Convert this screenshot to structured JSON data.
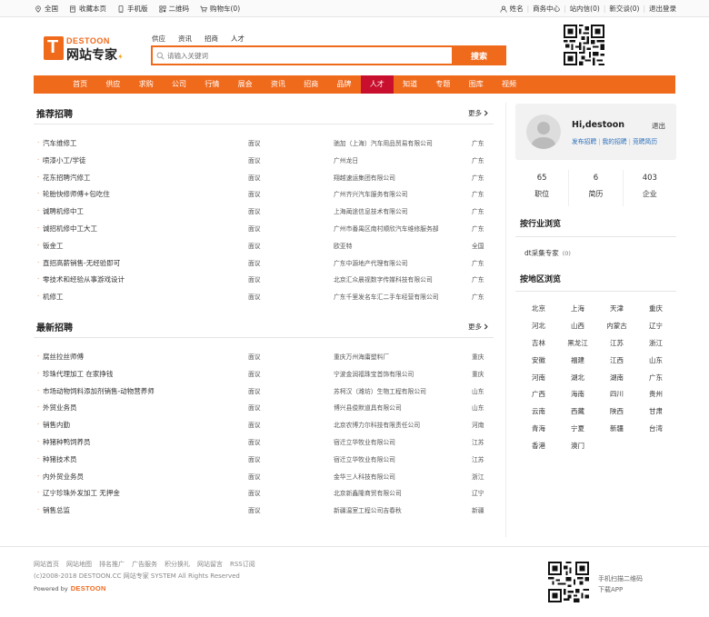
{
  "topbar": {
    "left": [
      {
        "icon": "location-icon",
        "label": "全国"
      },
      {
        "icon": "bookmark-icon",
        "label": "收藏本页"
      },
      {
        "icon": "phone-icon",
        "label": "手机版"
      },
      {
        "icon": "qrcode-icon",
        "label": "二维码"
      },
      {
        "icon": "cart-icon",
        "label": "购物车(0)"
      }
    ],
    "right": [
      "姓名",
      "商务中心",
      "站内信(0)",
      "新交谈(0)",
      "退出登录"
    ]
  },
  "logo": {
    "en": "DESTOON",
    "cn": "网站专家"
  },
  "search": {
    "tabs": [
      "供应",
      "资讯",
      "招商",
      "人才"
    ],
    "placeholder": "请输入关键词",
    "button": "搜索"
  },
  "nav": {
    "items": [
      "首页",
      "供应",
      "求购",
      "公司",
      "行情",
      "展会",
      "资讯",
      "招商",
      "品牌",
      "人才",
      "知道",
      "专题",
      "图库",
      "视频"
    ],
    "active": "人才"
  },
  "recommended": {
    "title": "推荐招聘",
    "more": "更多",
    "rows": [
      {
        "job": "汽车维修工",
        "salary": "面议",
        "company": "驰加（上海）汽车用品贸易有限公司",
        "area": "广东"
      },
      {
        "job": "喷漆小工/学徒",
        "salary": "面议",
        "company": "广州龙日",
        "area": "广东"
      },
      {
        "job": "花东招聘汽修工",
        "salary": "面议",
        "company": "翔越速运集团有限公司",
        "area": "广东"
      },
      {
        "job": "轮胎快修师傅+包吃住",
        "salary": "面议",
        "company": "广州齐兴汽车服务有限公司",
        "area": "广东"
      },
      {
        "job": "诚聘机修中工",
        "salary": "面议",
        "company": "上海蔺途信息技术有限公司",
        "area": "广东"
      },
      {
        "job": "诚招机修中工大工",
        "salary": "面议",
        "company": "广州市番禺区南村顺欣汽车维修服务部",
        "area": "广东"
      },
      {
        "job": "钣金工",
        "salary": "面议",
        "company": "欧亚特",
        "area": "全国"
      },
      {
        "job": "直招高薪销售-无经验即可",
        "salary": "面议",
        "company": "广东中源地产代理有限公司",
        "area": "广东"
      },
      {
        "job": "零技术和经验从事游戏设计",
        "salary": "面议",
        "company": "北京汇众晨视数字传媒科技有限公司",
        "area": "广东"
      },
      {
        "job": "机修工",
        "salary": "面议",
        "company": "广东千里发名车汇二手车经营有限公司",
        "area": "广东"
      }
    ]
  },
  "latest": {
    "title": "最新招聘",
    "more": "更多",
    "rows": [
      {
        "job": "腐丝拉丝师傅",
        "salary": "面议",
        "company": "重庆万州海庸塑料厂",
        "area": "重庆"
      },
      {
        "job": "珍珠代理加工 在家挣钱",
        "salary": "面议",
        "company": "宁波金润福珠宝首饰有限公司",
        "area": "重庆"
      },
      {
        "job": "市场动物饲料添加剂销售-动物营养师",
        "salary": "面议",
        "company": "苏柯汉（潍坊）生物工程有限公司",
        "area": "山东"
      },
      {
        "job": "外贸业务员",
        "salary": "面议",
        "company": "博兴县俊默道具有限公司",
        "area": "山东"
      },
      {
        "job": "销售内勤",
        "salary": "面议",
        "company": "北京农博力尔科技有限责任公司",
        "area": "河南"
      },
      {
        "job": "种猪种鸭饲养员",
        "salary": "面议",
        "company": "宿迁立华牧业有限公司",
        "area": "江苏"
      },
      {
        "job": "种猪技术员",
        "salary": "面议",
        "company": "宿迁立华牧业有限公司",
        "area": "江苏"
      },
      {
        "job": "内外贸业务员",
        "salary": "面议",
        "company": "金华三人科技有限公司",
        "area": "浙江"
      },
      {
        "job": "辽宁珍珠外发加工 无押金",
        "salary": "面议",
        "company": "北京新鑫隆商贸有限公司",
        "area": "辽宁"
      },
      {
        "job": "销售总监",
        "salary": "面议",
        "company": "新疆温室工程公司吉春秋",
        "area": "新疆"
      }
    ]
  },
  "user": {
    "greeting": "Hi,destoon",
    "logout": "退出",
    "links": [
      "发布招聘",
      "我的招聘",
      "竞聘简历"
    ]
  },
  "stats": [
    {
      "num": "65",
      "label": "职位"
    },
    {
      "num": "6",
      "label": "简历"
    },
    {
      "num": "403",
      "label": "企业"
    }
  ],
  "browse_industry": {
    "title": "按行业浏览",
    "item": "dt采集专家",
    "count": "(0)"
  },
  "browse_region": {
    "title": "按地区浏览",
    "items": [
      "北京",
      "上海",
      "天津",
      "重庆",
      "河北",
      "山西",
      "内蒙古",
      "辽宁",
      "吉林",
      "黑龙江",
      "江苏",
      "浙江",
      "安徽",
      "福建",
      "江西",
      "山东",
      "河南",
      "湖北",
      "湖南",
      "广东",
      "广西",
      "海南",
      "四川",
      "贵州",
      "云南",
      "西藏",
      "陕西",
      "甘肃",
      "青海",
      "宁夏",
      "新疆",
      "台湾",
      "香港",
      "澳门"
    ]
  },
  "footer": {
    "links": [
      "网站首页",
      "网站地图",
      "排名推广",
      "广告服务",
      "积分换礼",
      "网站留言",
      "RSS订阅"
    ],
    "copyright": "(c)2008-2018 DESTOON.CC 网站专家 SYSTEM All Rights Reserved",
    "powered_prefix": "Powered by",
    "powered_brand": "DESTOON",
    "qr_line1": "手机扫描二维码",
    "qr_line2": "下载APP"
  },
  "colors": {
    "accent": "#f06a1c",
    "nav_active": "#c8102e",
    "link": "#2a6fba"
  }
}
